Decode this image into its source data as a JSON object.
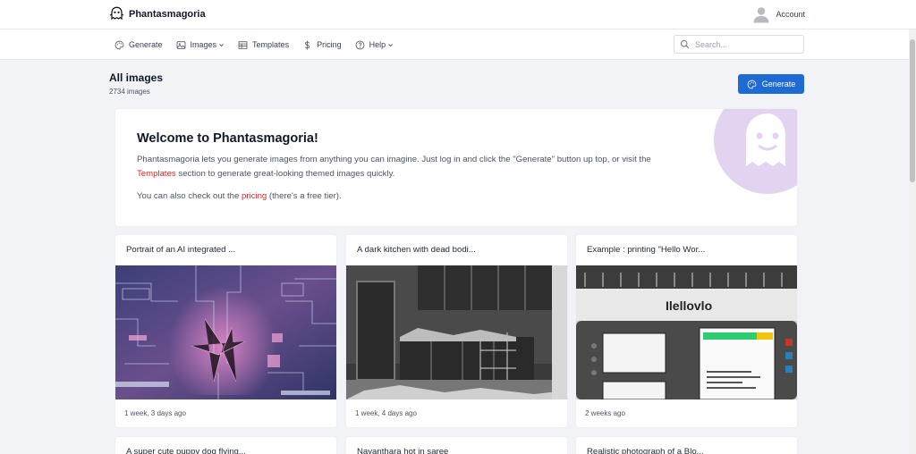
{
  "app": {
    "name": "Phantasmagoria",
    "account_label": "Account"
  },
  "nav": {
    "items": [
      {
        "label": "Generate",
        "icon": "palette-icon"
      },
      {
        "label": "Images",
        "icon": "image-icon",
        "dropdown": true
      },
      {
        "label": "Templates",
        "icon": "table-icon"
      },
      {
        "label": "Pricing",
        "icon": "dollar-icon"
      },
      {
        "label": "Help",
        "icon": "question-circle-icon",
        "dropdown": true
      }
    ],
    "search_placeholder": "Search..."
  },
  "header": {
    "title": "All images",
    "count": "2734 images",
    "generate_button": "Generate"
  },
  "welcome": {
    "title": "Welcome to Phantasmagoria!",
    "p1_before": "Phantasmagoria lets you generate images from anything you can imagine. Just log in and click the \"Generate\" button up top, or visit the ",
    "p1_link": "Templates",
    "p1_after": " section to generate great-looking themed images quickly.",
    "p2_before": "You can also check out the ",
    "p2_link": "pricing",
    "p2_after": " (there's a free tier)."
  },
  "images": [
    {
      "title": "Portrait of an AI integrated ...",
      "time": "1 week, 3 days ago"
    },
    {
      "title": "A dark kitchen with dead bodi...",
      "time": "1 week, 4 days ago"
    },
    {
      "title": "Example : printing \"Hello Wor...",
      "time": "2 weeks ago"
    },
    {
      "title": "A super cute puppy dog flying..."
    },
    {
      "title": "Nayanthara hot in saree"
    },
    {
      "title": "Realistic photograph of a Blo..."
    }
  ],
  "image3_text": "Ilellovlo",
  "colors": {
    "accent": "#1e6bd6",
    "link": "#dc2626",
    "ghost": "#e2d4f0"
  }
}
